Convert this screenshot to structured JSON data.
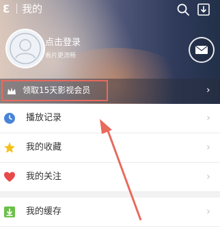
{
  "header": {
    "logo_glyph": "ℇ",
    "title": "我的",
    "login_text": "点击登录",
    "login_sub": "看片更流畅"
  },
  "vip_banner": {
    "text": "领取15天影视会员",
    "chevron": "›"
  },
  "menu": {
    "items": [
      {
        "label": "播放记录",
        "chevron": "›"
      },
      {
        "label": "我的收藏",
        "chevron": "›"
      },
      {
        "label": "我的关注",
        "chevron": "›"
      },
      {
        "label": "我的缓存",
        "chevron": "›"
      }
    ]
  },
  "colors": {
    "highlight": "#e86a5d",
    "history_icon": "#4a84d6",
    "favorite_icon": "#f5c21b",
    "follow_icon": "#e84a4a",
    "cache_icon": "#6cc04a"
  }
}
